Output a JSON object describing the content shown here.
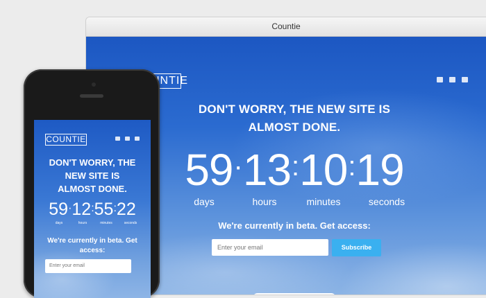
{
  "window": {
    "title": "Countie"
  },
  "brand": {
    "logo_text": "COUNTIE"
  },
  "social": {
    "icons": [
      "twitter-icon",
      "facebook-icon",
      "mail-icon"
    ]
  },
  "desktop": {
    "headline_line1": "DON'T WORRY, THE NEW SITE IS",
    "headline_line2": "ALMOST DONE.",
    "countdown": {
      "days": "59",
      "hours": "13",
      "minutes": "10",
      "seconds": "19"
    },
    "units": {
      "days": "days",
      "hours": "hours",
      "minutes": "minutes",
      "seconds": "seconds"
    },
    "beta_text": "We're currently in beta. Get access:",
    "email_placeholder": "Enter your email",
    "subscribe_label": "Subscribe"
  },
  "mobile": {
    "headline_line1": "DON'T WORRY, THE",
    "headline_line2": "NEW SITE IS",
    "headline_line3": "ALMOST DONE.",
    "countdown": {
      "days": "59",
      "hours": "12",
      "minutes": "55",
      "seconds": "22"
    },
    "units": {
      "days": "days",
      "hours": "hours",
      "minutes": "minutes",
      "seconds": "seconds"
    },
    "beta_line1": "We're currently in beta. Get",
    "beta_line2": "access:",
    "email_placeholder": "Enter your email"
  },
  "colors": {
    "accent": "#3ab0f0",
    "background_top": "#1c57c2",
    "background_bottom": "#8cb4e5"
  }
}
